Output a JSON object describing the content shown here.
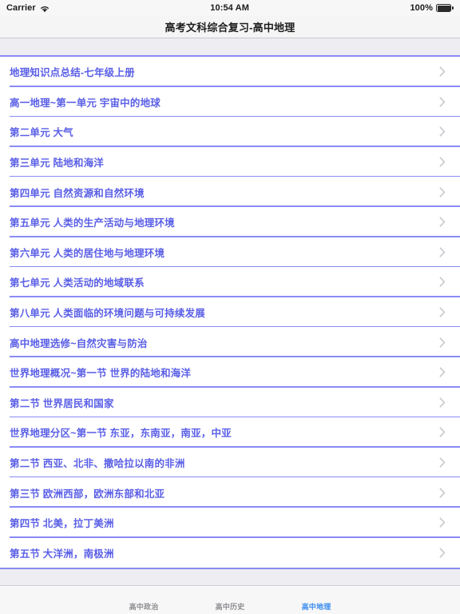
{
  "status_bar": {
    "carrier": "Carrier",
    "wifi_icon": "wifi-icon",
    "time": "10:54 AM",
    "battery_percent": "100%",
    "battery_icon": "battery-full-icon"
  },
  "navbar": {
    "title": "高考文科综合复习-高中地理"
  },
  "colors": {
    "link_text": "#5a5fe6",
    "separator": "#8a8bf5",
    "band": "#ededf2",
    "tab_active": "#3a8cf0",
    "tab_inactive": "#8e8e93",
    "chevron": "#c7c7cc"
  },
  "list": {
    "items": [
      {
        "label": "地理知识点总结-七年级上册",
        "accessory": "chevron-right-icon"
      },
      {
        "label": "高一地理~第一单元  宇宙中的地球",
        "accessory": "chevron-right-icon"
      },
      {
        "label": "第二单元  大气",
        "accessory": "chevron-right-icon"
      },
      {
        "label": "第三单元  陆地和海洋",
        "accessory": "chevron-right-icon"
      },
      {
        "label": "第四单元 自然资源和自然环境",
        "accessory": "chevron-right-icon"
      },
      {
        "label": "第五单元 人类的生产活动与地理环境",
        "accessory": "chevron-right-icon"
      },
      {
        "label": "第六单元 人类的居住地与地理环境",
        "accessory": "chevron-right-icon"
      },
      {
        "label": "第七单元 人类活动的地域联系",
        "accessory": "chevron-right-icon"
      },
      {
        "label": "第八单元 人类面临的环境问题与可持续发展",
        "accessory": "chevron-right-icon"
      },
      {
        "label": "高中地理选修~自然灾害与防治",
        "accessory": "chevron-right-icon"
      },
      {
        "label": "世界地理概况~第一节  世界的陆地和海洋",
        "accessory": "chevron-right-icon"
      },
      {
        "label": "第二节 世界居民和国家",
        "accessory": "chevron-right-icon"
      },
      {
        "label": "世界地理分区~第一节  东亚，东南亚，南亚，中亚",
        "accessory": "chevron-right-icon"
      },
      {
        "label": "第二节 西亚、北非、撒哈拉以南的非洲",
        "accessory": "chevron-right-icon"
      },
      {
        "label": "第三节 欧洲西部，欧洲东部和北亚",
        "accessory": "chevron-right-icon"
      },
      {
        "label": "第四节 北美，拉丁美洲",
        "accessory": "chevron-right-icon"
      },
      {
        "label": "第五节 大洋洲，南极洲",
        "accessory": "chevron-right-icon"
      }
    ]
  },
  "tabbar": {
    "tabs": [
      {
        "label": "高中政治",
        "active": false
      },
      {
        "label": "高中历史",
        "active": false
      },
      {
        "label": "高中地理",
        "active": true
      }
    ]
  }
}
